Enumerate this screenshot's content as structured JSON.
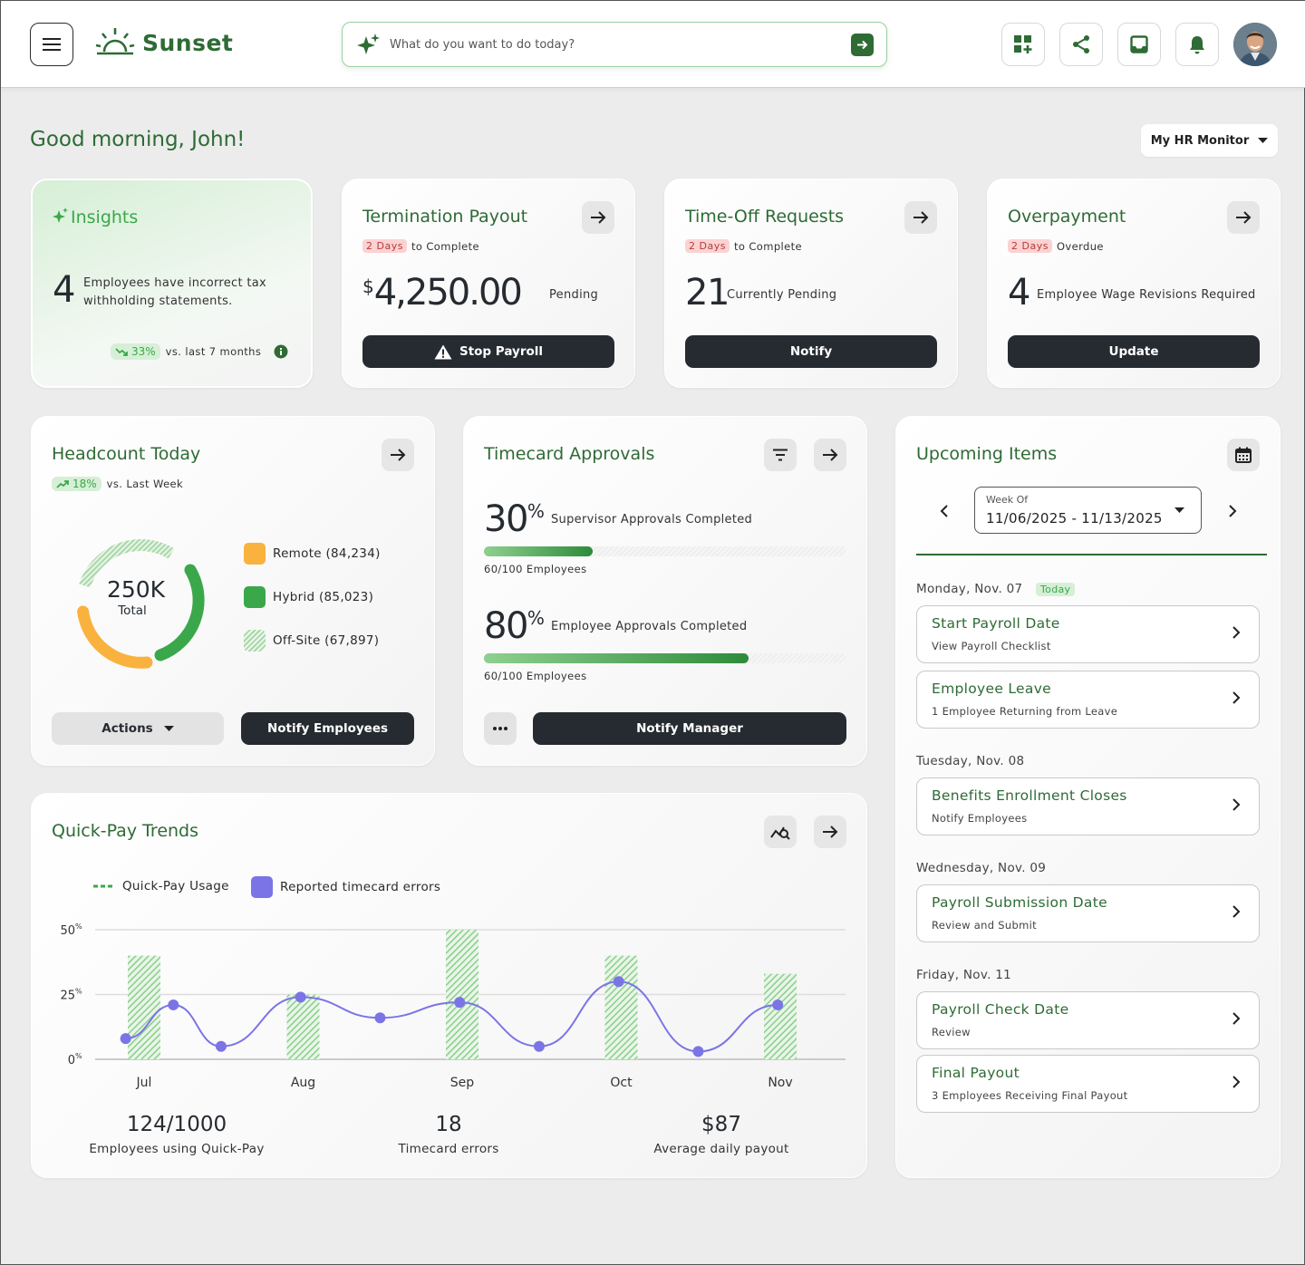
{
  "header": {
    "app_name": "Sunset",
    "search_placeholder": "What do you want to do today?"
  },
  "greeting": "Good morning, John!",
  "monitor_select": "My HR Monitor",
  "insights": {
    "title": "Insights",
    "count": "4",
    "text": "Employees have incorrect tax withholding statements.",
    "trend_value": "33%",
    "trend_label": "vs. last 7 months"
  },
  "termination": {
    "title": "Termination Payout",
    "pill": "2 Days",
    "pill_suffix": "to Complete",
    "currency": "$",
    "amount": "4,250.00",
    "status": "Pending",
    "button": "Stop Payroll"
  },
  "timeoff": {
    "title": "Time-Off Requests",
    "pill": "2 Days",
    "pill_suffix": "to Complete",
    "count": "21",
    "status": "Currently Pending",
    "button": "Notify"
  },
  "overpayment": {
    "title": "Overpayment",
    "pill": "2 Days",
    "pill_suffix": "Overdue",
    "count": "4",
    "status": "Employee Wage Revisions Required",
    "button": "Update"
  },
  "headcount": {
    "title": "Headcount Today",
    "trend_value": "18%",
    "trend_label": "vs. Last Week",
    "total_value": "250K",
    "total_label": "Total",
    "legend": [
      {
        "label": "Remote (84,234)",
        "color": "#f9a93a"
      },
      {
        "label": "Hybrid (85,023)",
        "color": "#3aa84a"
      },
      {
        "label": "Off-Site (67,897)",
        "color": "#a8d8a8"
      }
    ],
    "actions_button": "Actions",
    "notify_button": "Notify Employees"
  },
  "timecard": {
    "title": "Timecard Approvals",
    "items": [
      {
        "percent": "30",
        "label": "Supervisor Approvals Completed",
        "progress": 0.3,
        "sub": "60/100 Employees"
      },
      {
        "percent": "80",
        "label": "Employee Approvals Completed",
        "progress": 0.73,
        "sub": "60/100 Employees"
      }
    ],
    "percent_sign": "%",
    "notify_button": "Notify Manager"
  },
  "upcoming": {
    "title": "Upcoming Items",
    "week_label": "Week Of",
    "week_value": "11/06/2025 - 11/13/2025",
    "today_badge": "Today",
    "days": [
      {
        "label": "Monday, Nov. 07",
        "items": [
          {
            "title": "Start Payroll Date",
            "sub": "View Payroll Checklist"
          },
          {
            "title": "Employee Leave",
            "sub": "1 Employee Returning from Leave"
          }
        ]
      },
      {
        "label": "Tuesday, Nov. 08",
        "items": [
          {
            "title": "Benefits Enrollment Closes",
            "sub": "Notify Employees"
          }
        ]
      },
      {
        "label": "Wednesday, Nov. 09",
        "items": [
          {
            "title": "Payroll Submission Date",
            "sub": "Review and Submit"
          }
        ]
      },
      {
        "label": "Friday, Nov. 11",
        "items": [
          {
            "title": "Payroll Check Date",
            "sub": "Review"
          },
          {
            "title": "Final Payout",
            "sub": "3 Employees Receiving Final Payout"
          }
        ]
      }
    ]
  },
  "quickpay": {
    "title": "Quick-Pay Trends",
    "stats": [
      {
        "value": "124/1000",
        "label": "Employees using Quick-Pay"
      },
      {
        "value": "18",
        "label": "Timecard errors"
      },
      {
        "value": "$87",
        "label": "Average daily payout"
      }
    ]
  },
  "chart_data": {
    "type": "line",
    "legend": [
      "Quick-Pay Usage",
      "Reported timecard errors"
    ],
    "categories": [
      "Jul",
      "Aug",
      "Sep",
      "Oct",
      "Nov"
    ],
    "y_ticks": [
      "0",
      "25",
      "50"
    ],
    "y_tick_unit": "%",
    "ylim": [
      0,
      50
    ],
    "series": [
      {
        "name": "Reported timecard errors",
        "type": "bar",
        "color": "#a8d8a8",
        "x": [
          "Jul",
          "Aug",
          "Sep",
          "Oct",
          "Nov"
        ],
        "values": [
          40,
          25,
          50,
          40,
          33
        ]
      },
      {
        "name": "Quick-Pay Usage",
        "type": "line",
        "color": "#7b74e6",
        "x": [
          0.3,
          0.6,
          0.9,
          1.4,
          1.9,
          2.4,
          2.9,
          3.4,
          3.9,
          4.4
        ],
        "values": [
          8,
          21,
          5,
          24,
          16,
          22,
          5,
          30,
          3,
          21
        ]
      }
    ],
    "colors": {
      "accent": "#2e6b35",
      "line": "#7b74e6",
      "bars": "#a8d8a8"
    }
  }
}
